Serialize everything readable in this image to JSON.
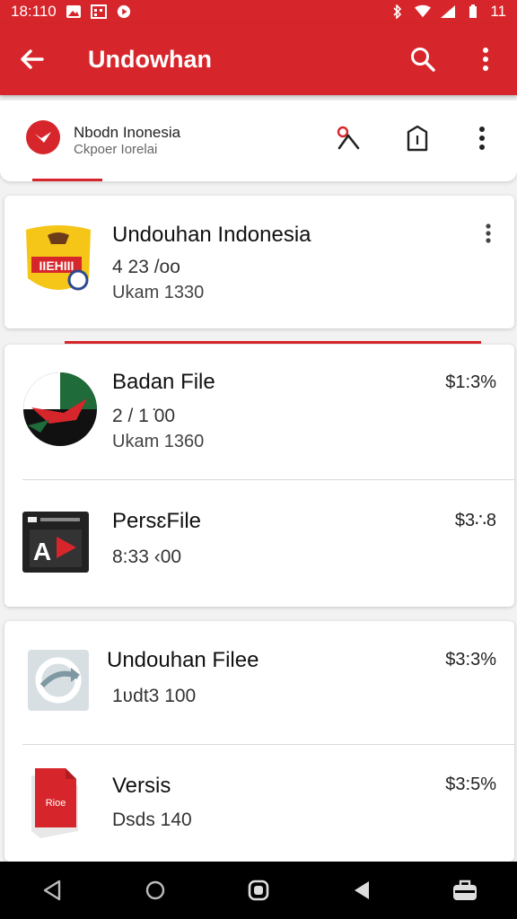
{
  "status_bar": {
    "time": "18:110",
    "battery": "11"
  },
  "app_bar": {
    "title": "Undowhan"
  },
  "account": {
    "name": "Nbodn Inonesia",
    "subtitle": "Ckpoer Iorelai"
  },
  "cards": [
    {
      "rows": [
        {
          "title": "Undouhan Indonesia",
          "line1": "4 23 /oo",
          "line2": "Ukam 1330",
          "price": ""
        }
      ]
    },
    {
      "rows": [
        {
          "title": "Badan File",
          "line1": "2 / 1 ̇00",
          "line2": "Ukam 1360",
          "price": "$1:3%"
        },
        {
          "title": "PersɛFile",
          "line1": "8:33 ‹00",
          "line2": "",
          "price": "$3∴8"
        }
      ]
    },
    {
      "rows": [
        {
          "title": "Undouhan Filee",
          "line1": "1ʋdt3 100",
          "line2": "",
          "price": "$3:3%"
        },
        {
          "title": "Versis",
          "line1": "Dsds 140",
          "line2": "",
          "price": "$3:5%"
        }
      ]
    }
  ],
  "thumbnails": {
    "badge_text": "IIEHIII",
    "film_label": "A",
    "doc_label": "Rioe"
  },
  "colors": {
    "primary": "#d7262b",
    "nav_bar": "#000000"
  },
  "icons": {
    "back": "arrow-left-icon",
    "search": "search-icon",
    "more": "more-vert-icon"
  }
}
